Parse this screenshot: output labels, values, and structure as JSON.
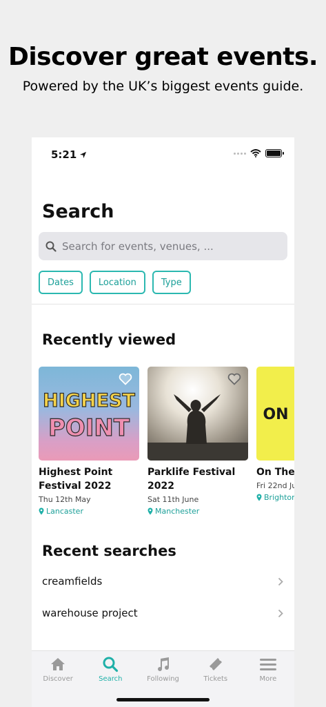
{
  "promo": {
    "headline": "Discover great events.",
    "subline": "Powered by the UK’s biggest events guide."
  },
  "status_bar": {
    "time": "5:21"
  },
  "page": {
    "title": "Search"
  },
  "search": {
    "placeholder": "Search for events, venues, ..."
  },
  "filters": [
    {
      "label": "Dates"
    },
    {
      "label": "Location"
    },
    {
      "label": "Type"
    }
  ],
  "recently_viewed": {
    "title": "Recently viewed",
    "cards": [
      {
        "name": "Highest Point Festival 2022",
        "date": "Thu 12th May",
        "location": "Lancaster",
        "image_text_1": "HIGHEST",
        "image_text_2": "POINT"
      },
      {
        "name": "Parklife Festival 2022",
        "date": "Sat 11th June",
        "location": "Manchester"
      },
      {
        "name": "On The Fatboy",
        "date": "Fri 22nd Ju",
        "location": "Brighton",
        "image_text": "ON"
      }
    ]
  },
  "recent_searches": {
    "title": "Recent searches",
    "items": [
      {
        "label": "creamfields"
      },
      {
        "label": "warehouse project"
      }
    ]
  },
  "tabbar": {
    "items": [
      {
        "label": "Discover",
        "icon": "home-icon"
      },
      {
        "label": "Search",
        "icon": "search-icon",
        "active": true
      },
      {
        "label": "Following",
        "icon": "music-note-icon"
      },
      {
        "label": "Tickets",
        "icon": "ticket-icon"
      },
      {
        "label": "More",
        "icon": "menu-icon"
      }
    ]
  },
  "colors": {
    "accent": "#1fb0a8",
    "chip_border": "#2bb8b0",
    "background": "#efefef"
  }
}
